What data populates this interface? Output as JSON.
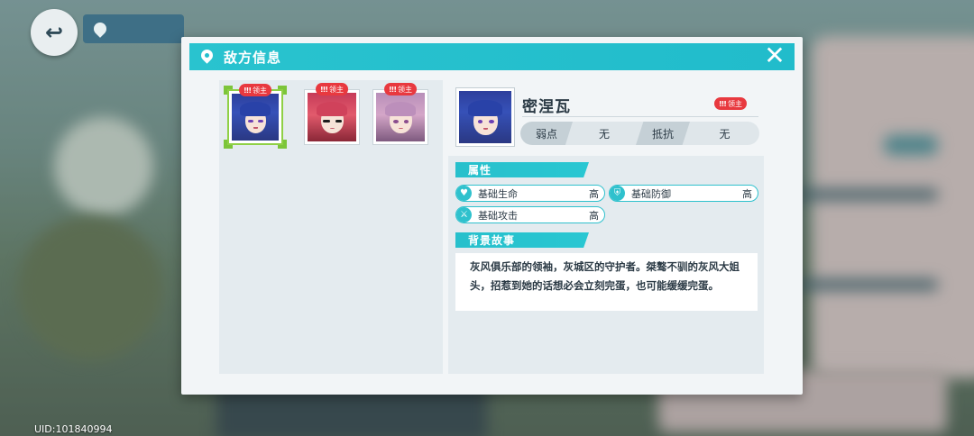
{
  "background": {
    "uid": "UID:101840994"
  },
  "dialog": {
    "title": "敌方信息",
    "close_icon": "close-icon",
    "enemies": [
      {
        "badge": "领主",
        "portrait": "blue-haired-girl",
        "selected": true
      },
      {
        "badge": "领主",
        "portrait": "red-haired-girl-sunglasses",
        "selected": false
      },
      {
        "badge": "领主",
        "portrait": "pink-haired-girl",
        "selected": false
      }
    ],
    "detail": {
      "name": "密涅瓦",
      "badge": "领主",
      "weakness_label": "弱点",
      "weakness_value": "无",
      "resistance_label": "抵抗",
      "resistance_value": "无",
      "attributes_title": "属性",
      "attributes": [
        {
          "label": "基础生命",
          "value": "高",
          "icon": "heart-icon"
        },
        {
          "label": "基础防御",
          "value": "高",
          "icon": "shield-icon"
        },
        {
          "label": "基础攻击",
          "value": "高",
          "icon": "sword-icon"
        }
      ],
      "story_title": "背景故事",
      "story": "灰风俱乐部的领袖，灰城区的守护者。桀骜不驯的灰风大姐头，招惹到她的话想必会立刻完蛋，也可能缓缓完蛋。"
    }
  },
  "colors": {
    "accent": "#29c3cf",
    "boss_badge": "#e8393f",
    "selected_frame": "#7cc53a"
  }
}
